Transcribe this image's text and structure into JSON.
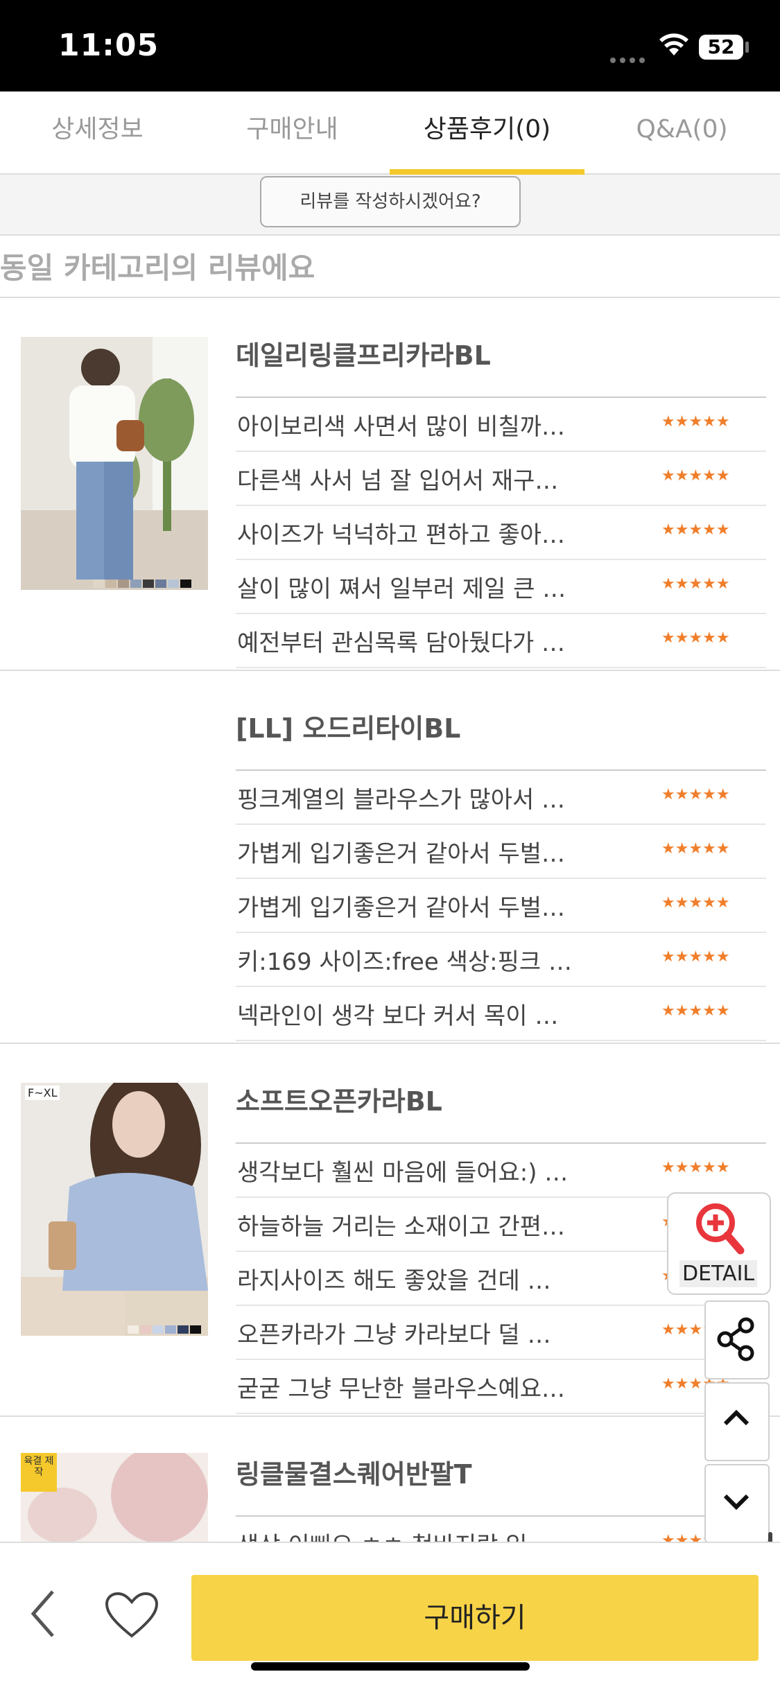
{
  "status": {
    "time": "11:05",
    "battery": "52"
  },
  "tabs": [
    {
      "label": "상세정보",
      "active": false
    },
    {
      "label": "구매안내",
      "active": false
    },
    {
      "label": "상품후기(0)",
      "active": true
    },
    {
      "label": "Q&A(0)",
      "active": false
    }
  ],
  "write_review_label": "리뷰를 작성하시겠어요?",
  "section_title": "동일 카테고리의 리뷰에요",
  "products": [
    {
      "name": "데일리링클프리카라BL",
      "has_image": true,
      "reviews": [
        "아이보리색 사면서 많이 비칠까…",
        "다른색 사서 넘 잘 입어서 재구…",
        "사이즈가 넉넉하고 편하고 좋아…",
        "살이 많이 쪄서 일부러 제일 큰 …",
        "예전부터 관심목록 담아뒀다가 …"
      ]
    },
    {
      "name": "[LL] 오드리타이BL",
      "has_image": false,
      "reviews": [
        "핑크계열의 블라우스가 많아서 …",
        "가볍게 입기좋은거 같아서 두벌…",
        "가볍게 입기좋은거 같아서 두벌…",
        "키:169 사이즈:free 색상:핑크 …",
        "넥라인이 생각 보다 커서 목이 …"
      ]
    },
    {
      "name": "소프트오픈카라BL",
      "has_image": true,
      "image_badge": "F~XL",
      "reviews": [
        "생각보다 훨씬 마음에 들어요:) …",
        "하늘하늘 거리는 소재이고 간편…",
        "라지사이즈 해도 좋았을 건데 …",
        "오픈카라가 그냥 카라보다 덜 …",
        "굳굳 그냥 무난한 블라우스예요…"
      ]
    },
    {
      "name": "링클물결스퀘어반팔T",
      "has_image": true,
      "image_badge": "육결 제작",
      "reviews": [
        "색상 이뻐요 ㅎㅎ 청바지랑 입…"
      ]
    }
  ],
  "stars": "★★★★★",
  "detail_label": "DETAIL",
  "buy_label": "구매하기",
  "colors": {
    "accent": "#f7d347",
    "star": "#f07e2a"
  }
}
